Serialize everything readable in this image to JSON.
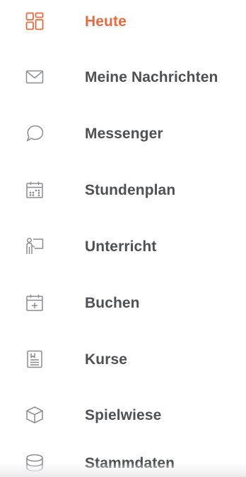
{
  "colors": {
    "active": "#e86a3e",
    "text": "#4f5055",
    "icon": "#8b8c90"
  },
  "nav": {
    "items": [
      {
        "label": "Heute",
        "icon": "dashboard-grid-icon",
        "active": true
      },
      {
        "label": "Meine Nachrichten",
        "icon": "envelope-icon",
        "active": false
      },
      {
        "label": "Messenger",
        "icon": "speech-bubble-icon",
        "active": false
      },
      {
        "label": "Stundenplan",
        "icon": "calendar-icon",
        "active": false
      },
      {
        "label": "Unterricht",
        "icon": "teacher-board-icon",
        "active": false
      },
      {
        "label": "Buchen",
        "icon": "calendar-add-icon",
        "active": false
      },
      {
        "label": "Kurse",
        "icon": "document-icon",
        "active": false
      },
      {
        "label": "Spielwiese",
        "icon": "cube-icon",
        "active": false
      },
      {
        "label": "Stammdaten",
        "icon": "database-icon",
        "active": false
      }
    ]
  }
}
